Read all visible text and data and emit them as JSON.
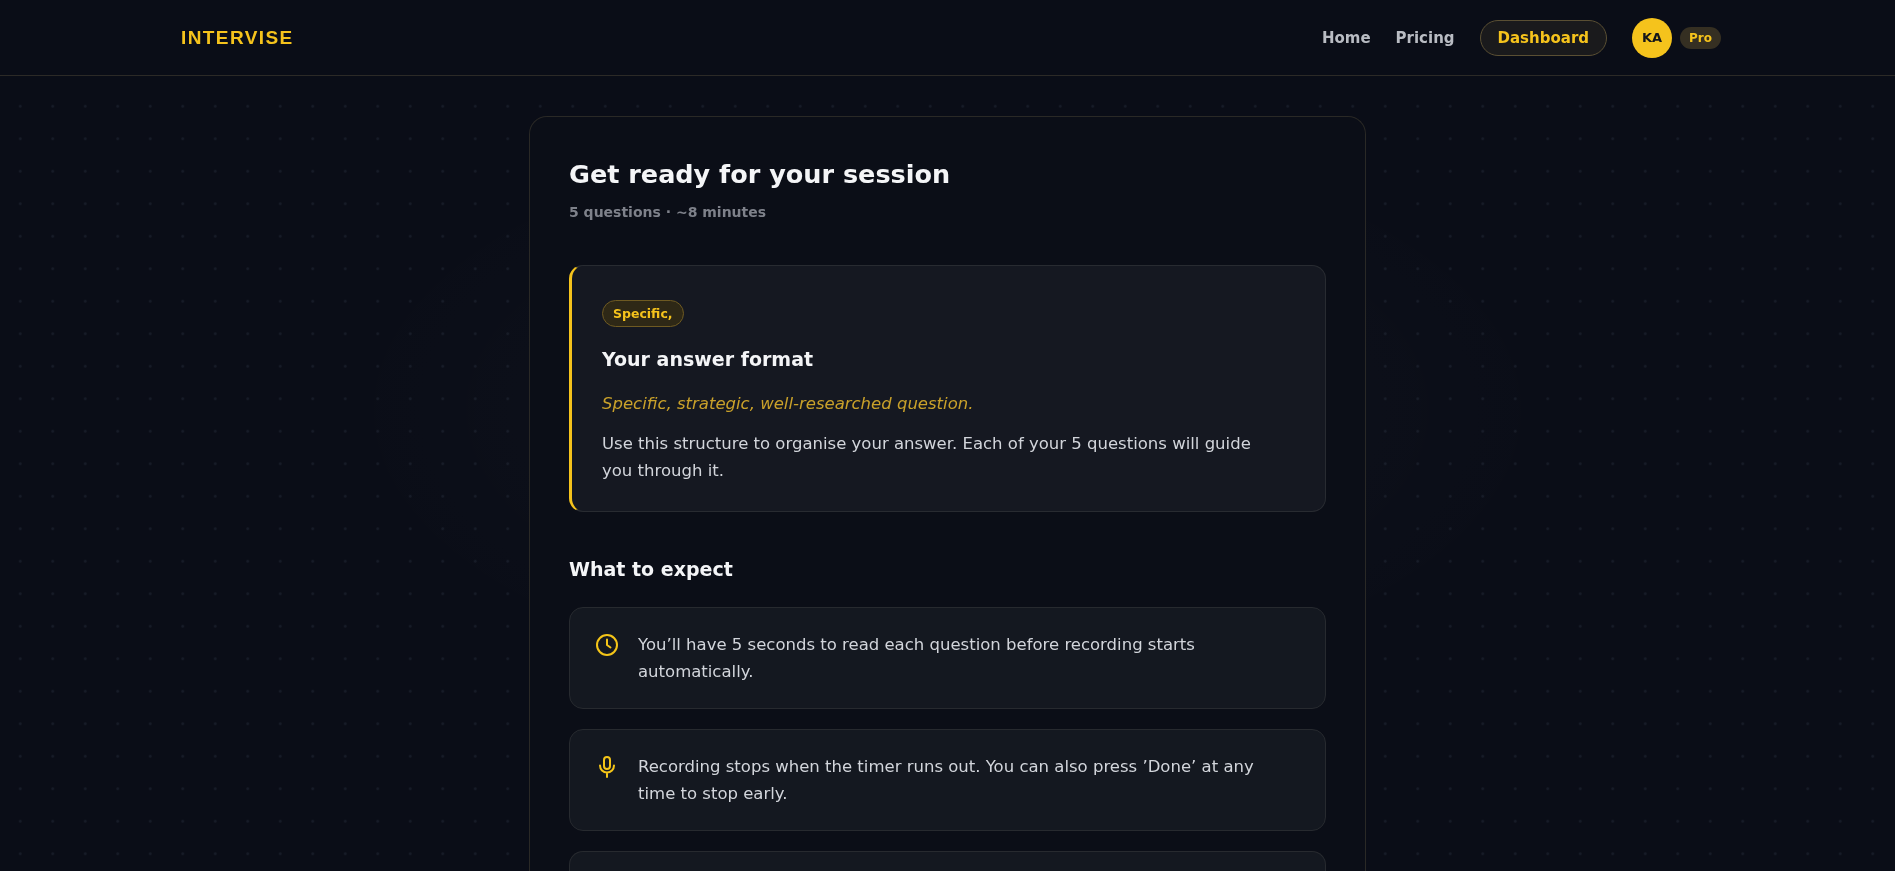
{
  "header": {
    "logo": "INTERVISE",
    "nav": [
      {
        "label": "Home",
        "kind": "link"
      },
      {
        "label": "Pricing",
        "kind": "link"
      },
      {
        "label": "Dashboard",
        "kind": "button"
      }
    ],
    "avatar": {
      "initials": "KA"
    },
    "plan_badge": "Pro"
  },
  "session": {
    "title": "Get ready for your session",
    "subtitle": "5 questions · ~8 minutes",
    "answer_format": {
      "tag": "Specific,",
      "title": "Your answer format",
      "summary": "Specific, strategic, well-researched question.",
      "description": "Use this structure to organise your answer. Each of your 5 questions will guide you through it."
    },
    "expect": {
      "title": "What to expect",
      "items": [
        {
          "kind": "timer",
          "text": "You’ll have 5 seconds to read each question before recording starts automatically."
        },
        {
          "kind": "recording",
          "text": "Recording stops when the timer runs out. You can also press ’Done’ at any time to stop early."
        }
      ]
    }
  }
}
